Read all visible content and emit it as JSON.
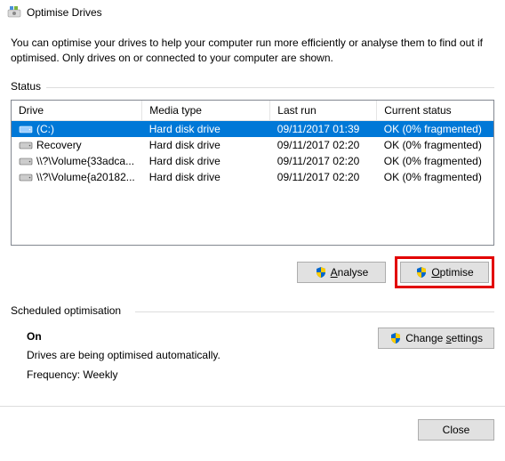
{
  "window": {
    "title": "Optimise Drives"
  },
  "description": "You can optimise your drives to help your computer run more efficiently or analyse them to find out if optimised. Only drives on or connected to your computer are shown.",
  "status": {
    "label": "Status",
    "columns": {
      "drive": "Drive",
      "media": "Media type",
      "last_run": "Last run",
      "current_status": "Current status"
    },
    "rows": [
      {
        "drive": "(C:)",
        "media": "Hard disk drive",
        "last_run": "09/11/2017 01:39",
        "status": "OK (0% fragmented)",
        "selected": true,
        "icon": "drive-c"
      },
      {
        "drive": "Recovery",
        "media": "Hard disk drive",
        "last_run": "09/11/2017 02:20",
        "status": "OK (0% fragmented)",
        "selected": false,
        "icon": "drive"
      },
      {
        "drive": "\\\\?\\Volume{33adca...",
        "media": "Hard disk drive",
        "last_run": "09/11/2017 02:20",
        "status": "OK (0% fragmented)",
        "selected": false,
        "icon": "drive"
      },
      {
        "drive": "\\\\?\\Volume{a20182...",
        "media": "Hard disk drive",
        "last_run": "09/11/2017 02:20",
        "status": "OK (0% fragmented)",
        "selected": false,
        "icon": "drive"
      }
    ]
  },
  "buttons": {
    "analyse": "Analyse",
    "optimise": "Optimise",
    "change_settings": "Change settings",
    "close": "Close"
  },
  "scheduled": {
    "label": "Scheduled optimisation",
    "state": "On",
    "desc": "Drives are being optimised automatically.",
    "frequency": "Frequency: Weekly"
  }
}
